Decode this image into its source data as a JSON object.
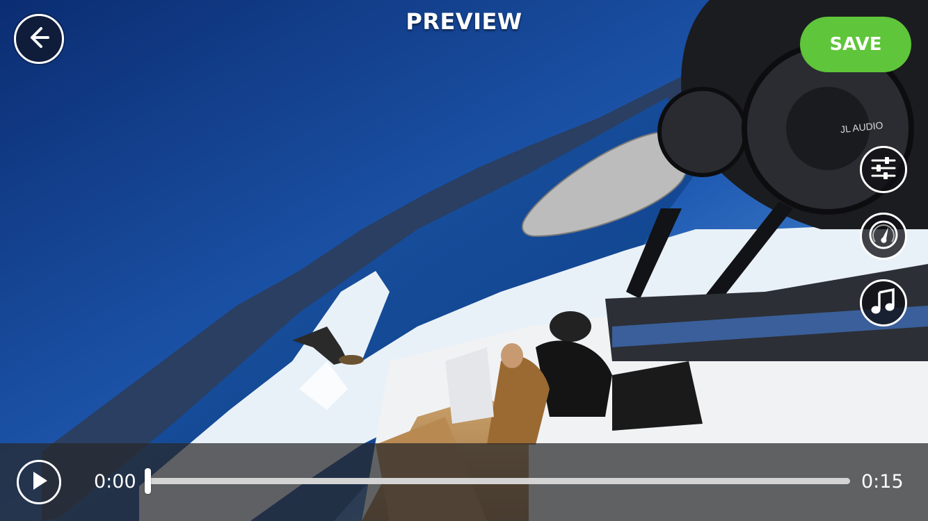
{
  "header": {
    "title": "PREVIEW",
    "back_icon": "arrow-left-icon",
    "save_label": "SAVE"
  },
  "tools": [
    {
      "name": "adjustments",
      "icon": "sliders-icon"
    },
    {
      "name": "speed",
      "icon": "speedometer-icon"
    },
    {
      "name": "music",
      "icon": "music-note-icon"
    }
  ],
  "scene": {
    "speaker_brand": "JL AUDIO"
  },
  "player": {
    "play_icon": "play-icon",
    "current_time": "0:00",
    "total_time": "0:15",
    "progress": 0
  },
  "colors": {
    "save_button": "#5fc53a",
    "back_button_fill": "#0f1d3a",
    "player_bar": "#28282a"
  }
}
